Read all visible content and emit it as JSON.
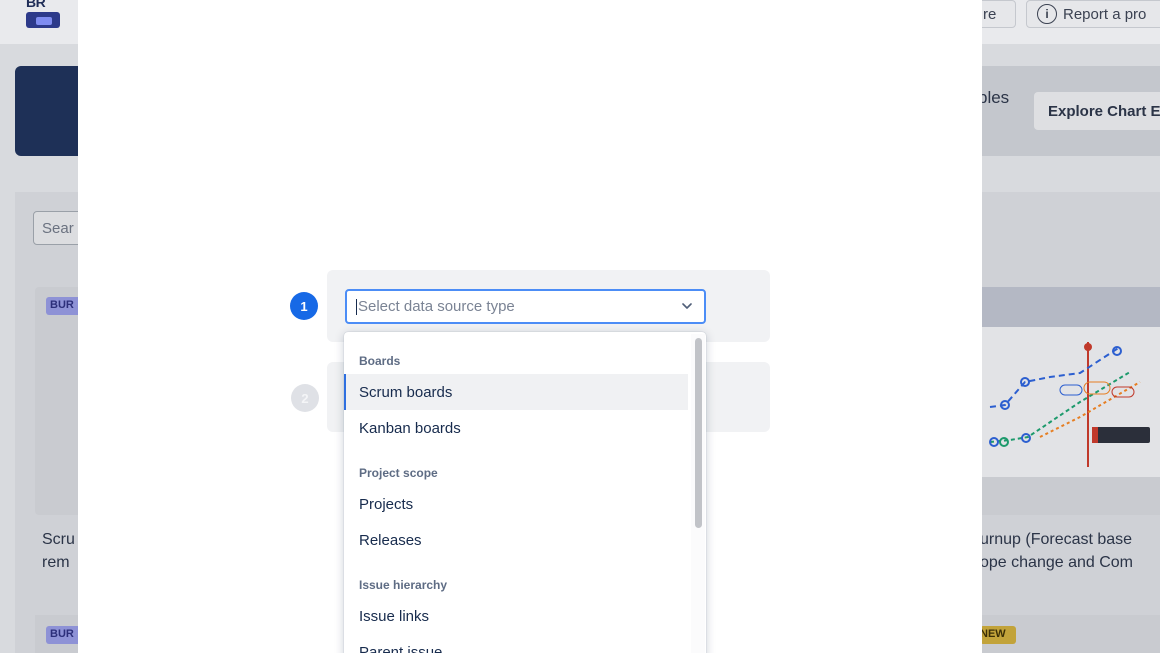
{
  "background": {
    "logo_text": "BR",
    "share_partial": "re",
    "report_button": "Report a pro",
    "banner_partial": "ples",
    "explore_button": "Explore Chart E",
    "search_partial": "Sear",
    "badge_bur": "BUR",
    "badge_new": "NEW",
    "card_left_title_line1": "Scru",
    "card_left_title_line2": "rem",
    "card_right_title_line1": "urnup (Forecast base",
    "card_right_title_line2": "ope change and Com"
  },
  "wizard": {
    "step1_number": "1",
    "step2_number": "2",
    "select": {
      "placeholder": "Select data source type"
    },
    "dropdown": {
      "groups": [
        {
          "label": "Boards",
          "options": [
            "Scrum boards",
            "Kanban boards"
          ]
        },
        {
          "label": "Project scope",
          "options": [
            "Projects",
            "Releases"
          ]
        },
        {
          "label": "Issue hierarchy",
          "options": [
            "Issue links",
            "Parent issue"
          ]
        }
      ],
      "active_option": "Scrum boards"
    }
  },
  "colors": {
    "accent": "#1769e6",
    "focus_border": "#4c8df6",
    "active_bar": "#2e6fe0"
  }
}
